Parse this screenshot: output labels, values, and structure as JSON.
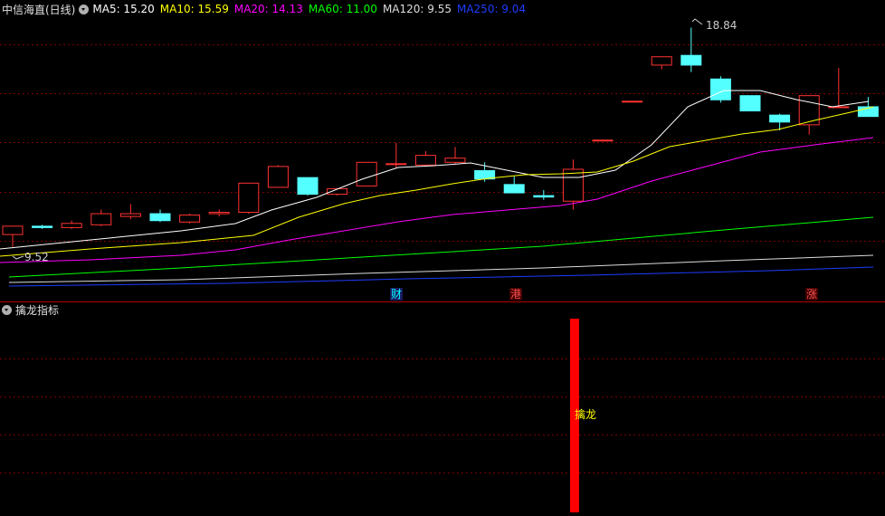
{
  "header": {
    "stock_name": "中信海直(日线)",
    "ma_labels": [
      {
        "text": "MA5: 15.20",
        "color": "#ffffff"
      },
      {
        "text": "MA10: 15.59",
        "color": "#ffff00"
      },
      {
        "text": "MA20: 14.13",
        "color": "#ff00ff"
      },
      {
        "text": "MA60: 11.00",
        "color": "#00ff00"
      },
      {
        "text": "MA120: 9.55",
        "color": "#dcdcdc"
      },
      {
        "text": "MA250: 9.04",
        "color": "#1e3cff"
      }
    ]
  },
  "price_labels": {
    "high": "18.84",
    "low": "9.52"
  },
  "events": [
    {
      "text": "财",
      "color": "#00ffff",
      "bg": "#1a1a60"
    },
    {
      "text": "港",
      "color": "#ff5050",
      "bg": "#400000"
    },
    {
      "text": "涨",
      "color": "#ff5050",
      "bg": "#400000"
    }
  ],
  "indicator": {
    "title": "擒龙指标",
    "signal_label": "擒龙"
  },
  "colors": {
    "up": "#ff3232",
    "down": "#54ffff",
    "grid": "#7a0000",
    "signal": "#ff0000"
  }
}
